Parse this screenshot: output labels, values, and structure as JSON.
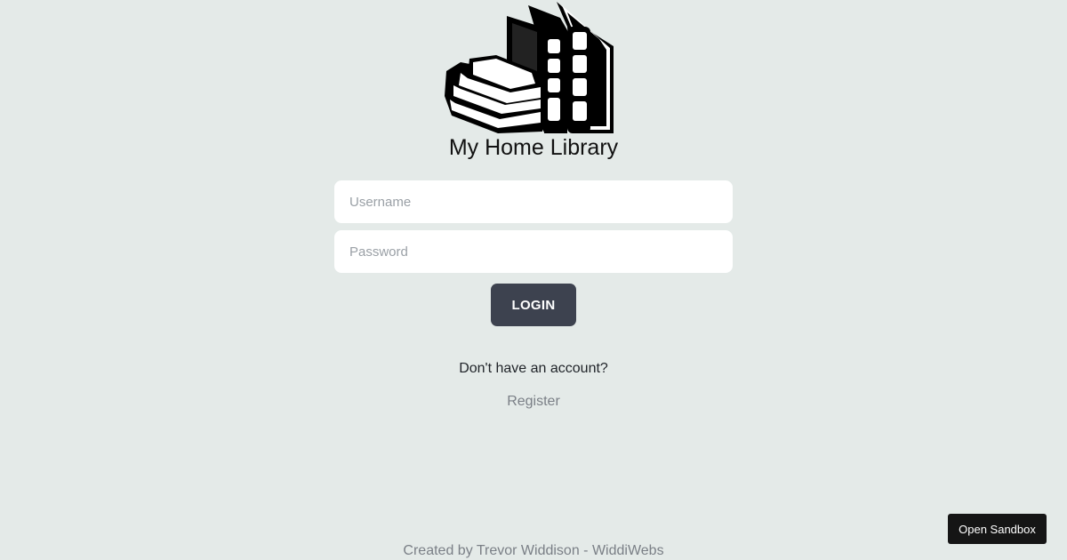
{
  "app": {
    "title": "My Home Library",
    "logo_icon": "books-stack-icon"
  },
  "login_form": {
    "username": {
      "placeholder": "Username",
      "value": ""
    },
    "password": {
      "placeholder": "Password",
      "value": ""
    },
    "login_label": "LOGIN"
  },
  "register": {
    "prompt": "Don't have an account?",
    "link_label": "Register"
  },
  "footer": {
    "credit": "Created by Trevor Widdison - WiddiWebs"
  },
  "sandbox": {
    "label": "Open Sandbox"
  },
  "colors": {
    "background": "#e4eae8",
    "button": "#3d424f",
    "muted_text": "#7a7f86"
  }
}
